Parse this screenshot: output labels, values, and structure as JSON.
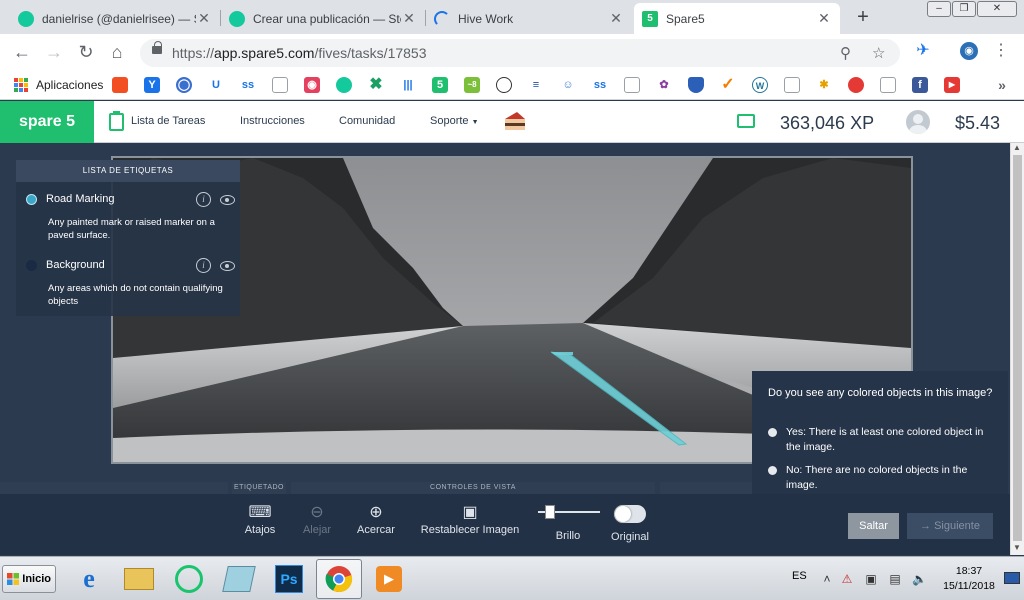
{
  "browser": {
    "tabs": [
      {
        "title": "danielrise (@danielrisee) — St",
        "favicon_color": "#14c99b"
      },
      {
        "title": "Crear una publicación — Steem",
        "favicon_color": "#14c99b"
      },
      {
        "title": "Hive Work",
        "favicon_color": "#1a73e8"
      },
      {
        "title": "Spare5",
        "favicon_color": "#1fbf6f",
        "favicon_glyph": "5"
      }
    ],
    "new_tab_glyph": "+",
    "close_glyph": "✕",
    "url_scheme": "https://",
    "url_host": "app.spare5.com",
    "url_path": "/fives/tasks/17853"
  },
  "bookmarks": {
    "apps_label": "Aplicaciones",
    "more_glyph": "»"
  },
  "app": {
    "logo": "spare 5",
    "nav": {
      "tasks": "Lista de Tareas",
      "instructions": "Instrucciones",
      "community": "Comunidad",
      "support": "Soporte"
    },
    "xp": "363,046 XP",
    "balance": "$5.43"
  },
  "labels_panel": {
    "title": "LISTA DE ETIQUETAS",
    "items": [
      {
        "name": "Road Marking",
        "description": "Any painted mark or raised marker on a paved surface.",
        "color": "#3aa7c8"
      },
      {
        "name": "Background",
        "description": "Any areas which do not contain qualifying objects",
        "color": "#1a2a44"
      }
    ]
  },
  "strip_labels": {
    "left": "ETIQUETADO",
    "center": "CONTROLES DE VISTA"
  },
  "question": {
    "text": "Do you see any colored objects in this image?",
    "options": [
      {
        "label": "Yes: There is at least one colored object in the image."
      },
      {
        "label": "No: There are no colored objects in the image."
      }
    ]
  },
  "toolbar": {
    "shortcuts": "Atajos",
    "zoom_out": "Alejar",
    "zoom_in": "Acercar",
    "reset_image": "Restablecer Imagen",
    "brightness": "Brillo",
    "brightness_level": 0.15,
    "original": "Original",
    "original_on": false,
    "skip": "Saltar",
    "next": "Siguiente"
  },
  "taskbar": {
    "start": "Inicio",
    "language": "ES",
    "time": "18:37",
    "date": "15/11/2018"
  },
  "colors": {
    "brand_green": "#1fbf6f",
    "work_bg": "#2b3a4f",
    "annotation": "#6fd0d8"
  }
}
